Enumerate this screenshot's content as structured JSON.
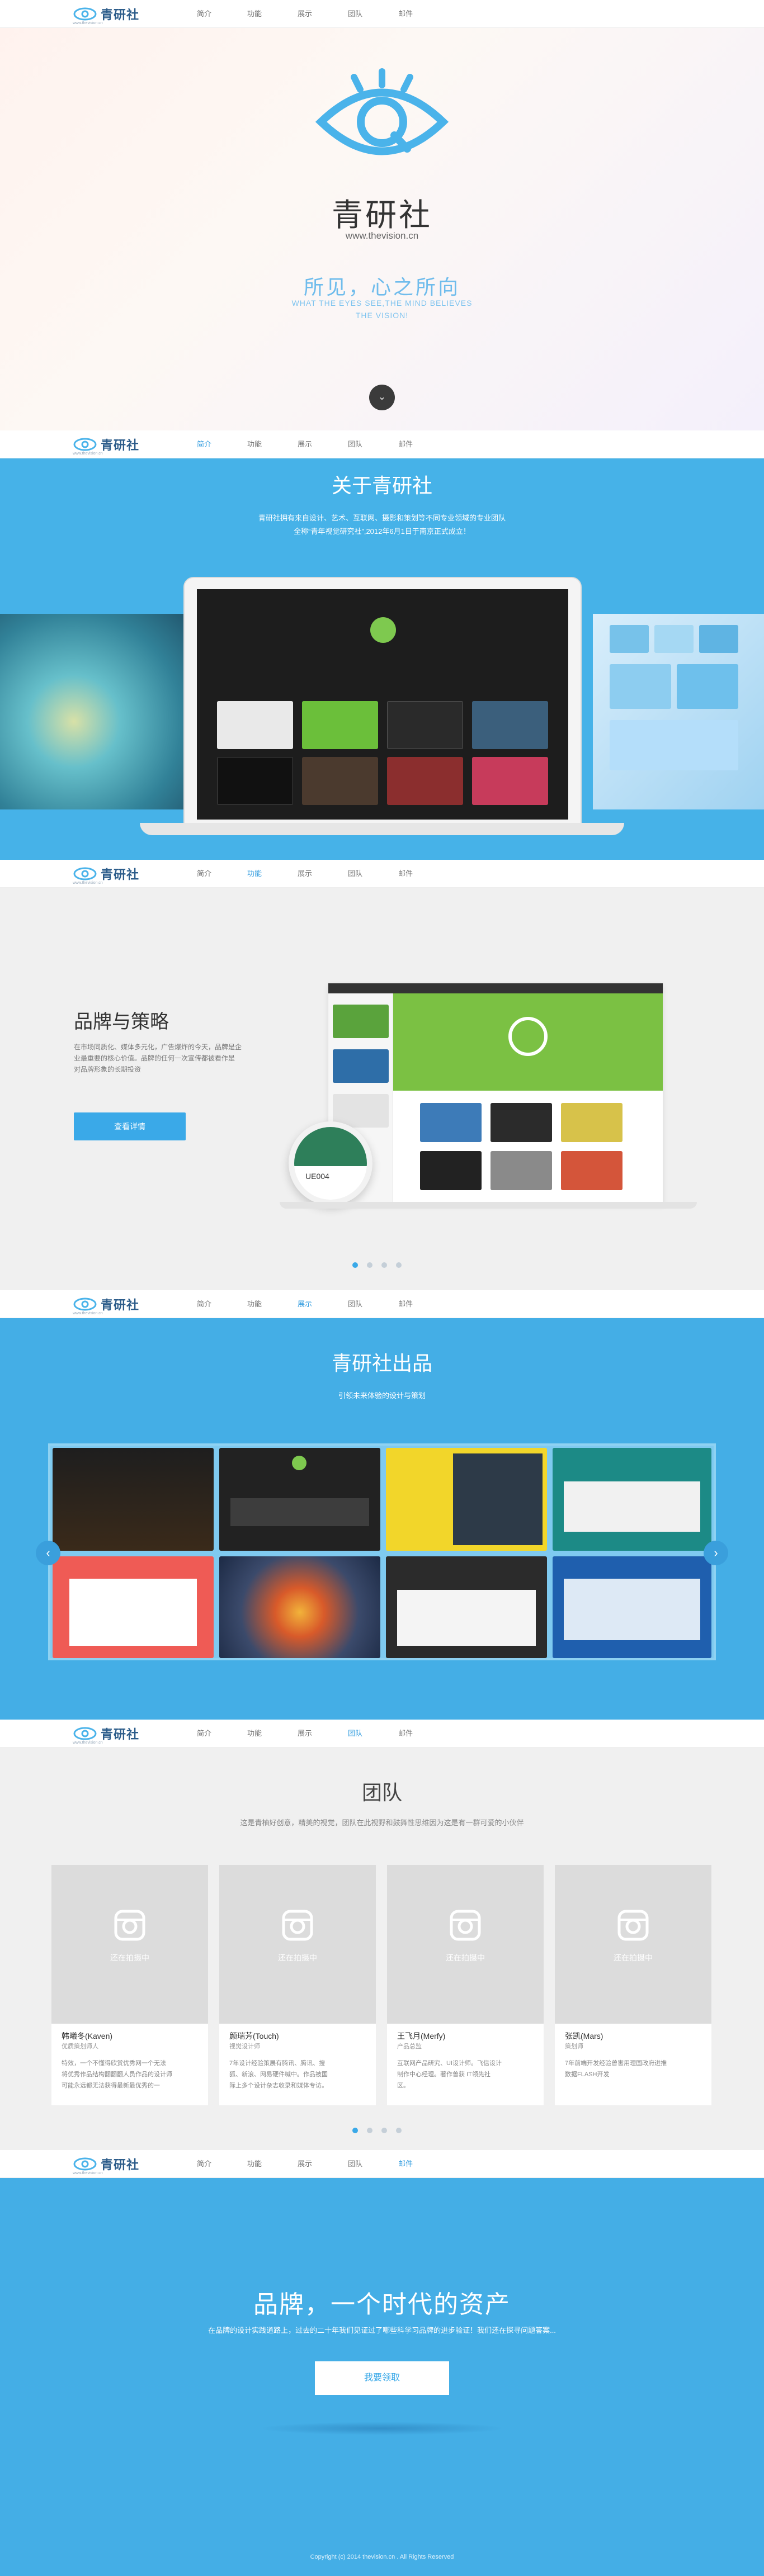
{
  "brand": {
    "name": "青研社",
    "sub": "www.thevision.cn",
    "tiny": "www.thevision.cn"
  },
  "nav": {
    "items": [
      "简介",
      "功能",
      "展示",
      "团队",
      "邮件"
    ]
  },
  "hero": {
    "title": "青研社",
    "url": "www.thevision.cn",
    "slogan": "所见，心之所向",
    "english": "WHAT THE EYES SEE,THE MIND BELIEVES",
    "english2": "THE VISION!"
  },
  "about": {
    "title": "关于青研社",
    "line1": "青研社拥有来自设计、艺术、互联网、摄影和策划等不同专业领域的专业团队",
    "line2": "全称“青年视觉研究社”,2012年6月1日于南京正式成立！"
  },
  "strategy": {
    "title": "品牌与策略",
    "desc1": "在市场同质化、媒体多元化，广告爆炸的今天，品牌是企",
    "desc2": "业最重要的核心价值。品牌的任何一次宣传都被看作是",
    "desc3": "对品牌形象的长期投资",
    "button": "查看详情",
    "badge": "UE004"
  },
  "works": {
    "title": "青研社出品",
    "subtitle": "引领未来体验的设计与策划"
  },
  "team": {
    "title": "团队",
    "subtitle": "这是青柚好创意，精美的视觉，团队在此视野和鼓舞性思维因为这是有一群可爱的小伙伴",
    "placeholder": "还在拍摄中",
    "members": [
      {
        "name": "韩曦冬(Kaven)",
        "role": "优质策划师人",
        "desc1": "特效，一个不懂得欣赏优秀网一个无法",
        "desc2": "将优秀作品结构翻翻翻人员作品的设计师",
        "desc3": "可能永远都无法获得最新最优秀的一"
      },
      {
        "name": "颜瑞芳(Touch)",
        "role": "视觉设计师",
        "desc1": "7年设计经验策展有腾讯、腾讯、搜",
        "desc2": "狐、新浪、网易硬件喊中。作品被国",
        "desc3": "际上多个设计杂志收录和媒体专访。"
      },
      {
        "name": "王飞月(Merfy)",
        "role": "产品总监",
        "desc1": "互联网产品研究、UI设计师。飞信设计",
        "desc2": "制作中心经理。著作曾获 IT领先社",
        "desc3": "区。"
      },
      {
        "name": "张凯(Mars)",
        "role": "策划师",
        "desc1": "7年前端开发经验曾害用理国政府进推",
        "desc2": "数据FLASH开发",
        "desc3": ""
      }
    ]
  },
  "cta": {
    "title": "品牌，一个时代的资产",
    "desc": "在品牌的设计实践道路上，过去的二十年我们见证过了哪些科学习品牌的进步验证！我们还在探寻问题答案...",
    "button": "我要领取"
  },
  "footer": {
    "text": "Copyright (c) 2014 thevision.cn . All Rights Reserved"
  },
  "colors": {
    "accent": "#3aa9e8",
    "blue": "#44aee6",
    "grey": "#efefef",
    "navy": "#2c5c8a"
  }
}
